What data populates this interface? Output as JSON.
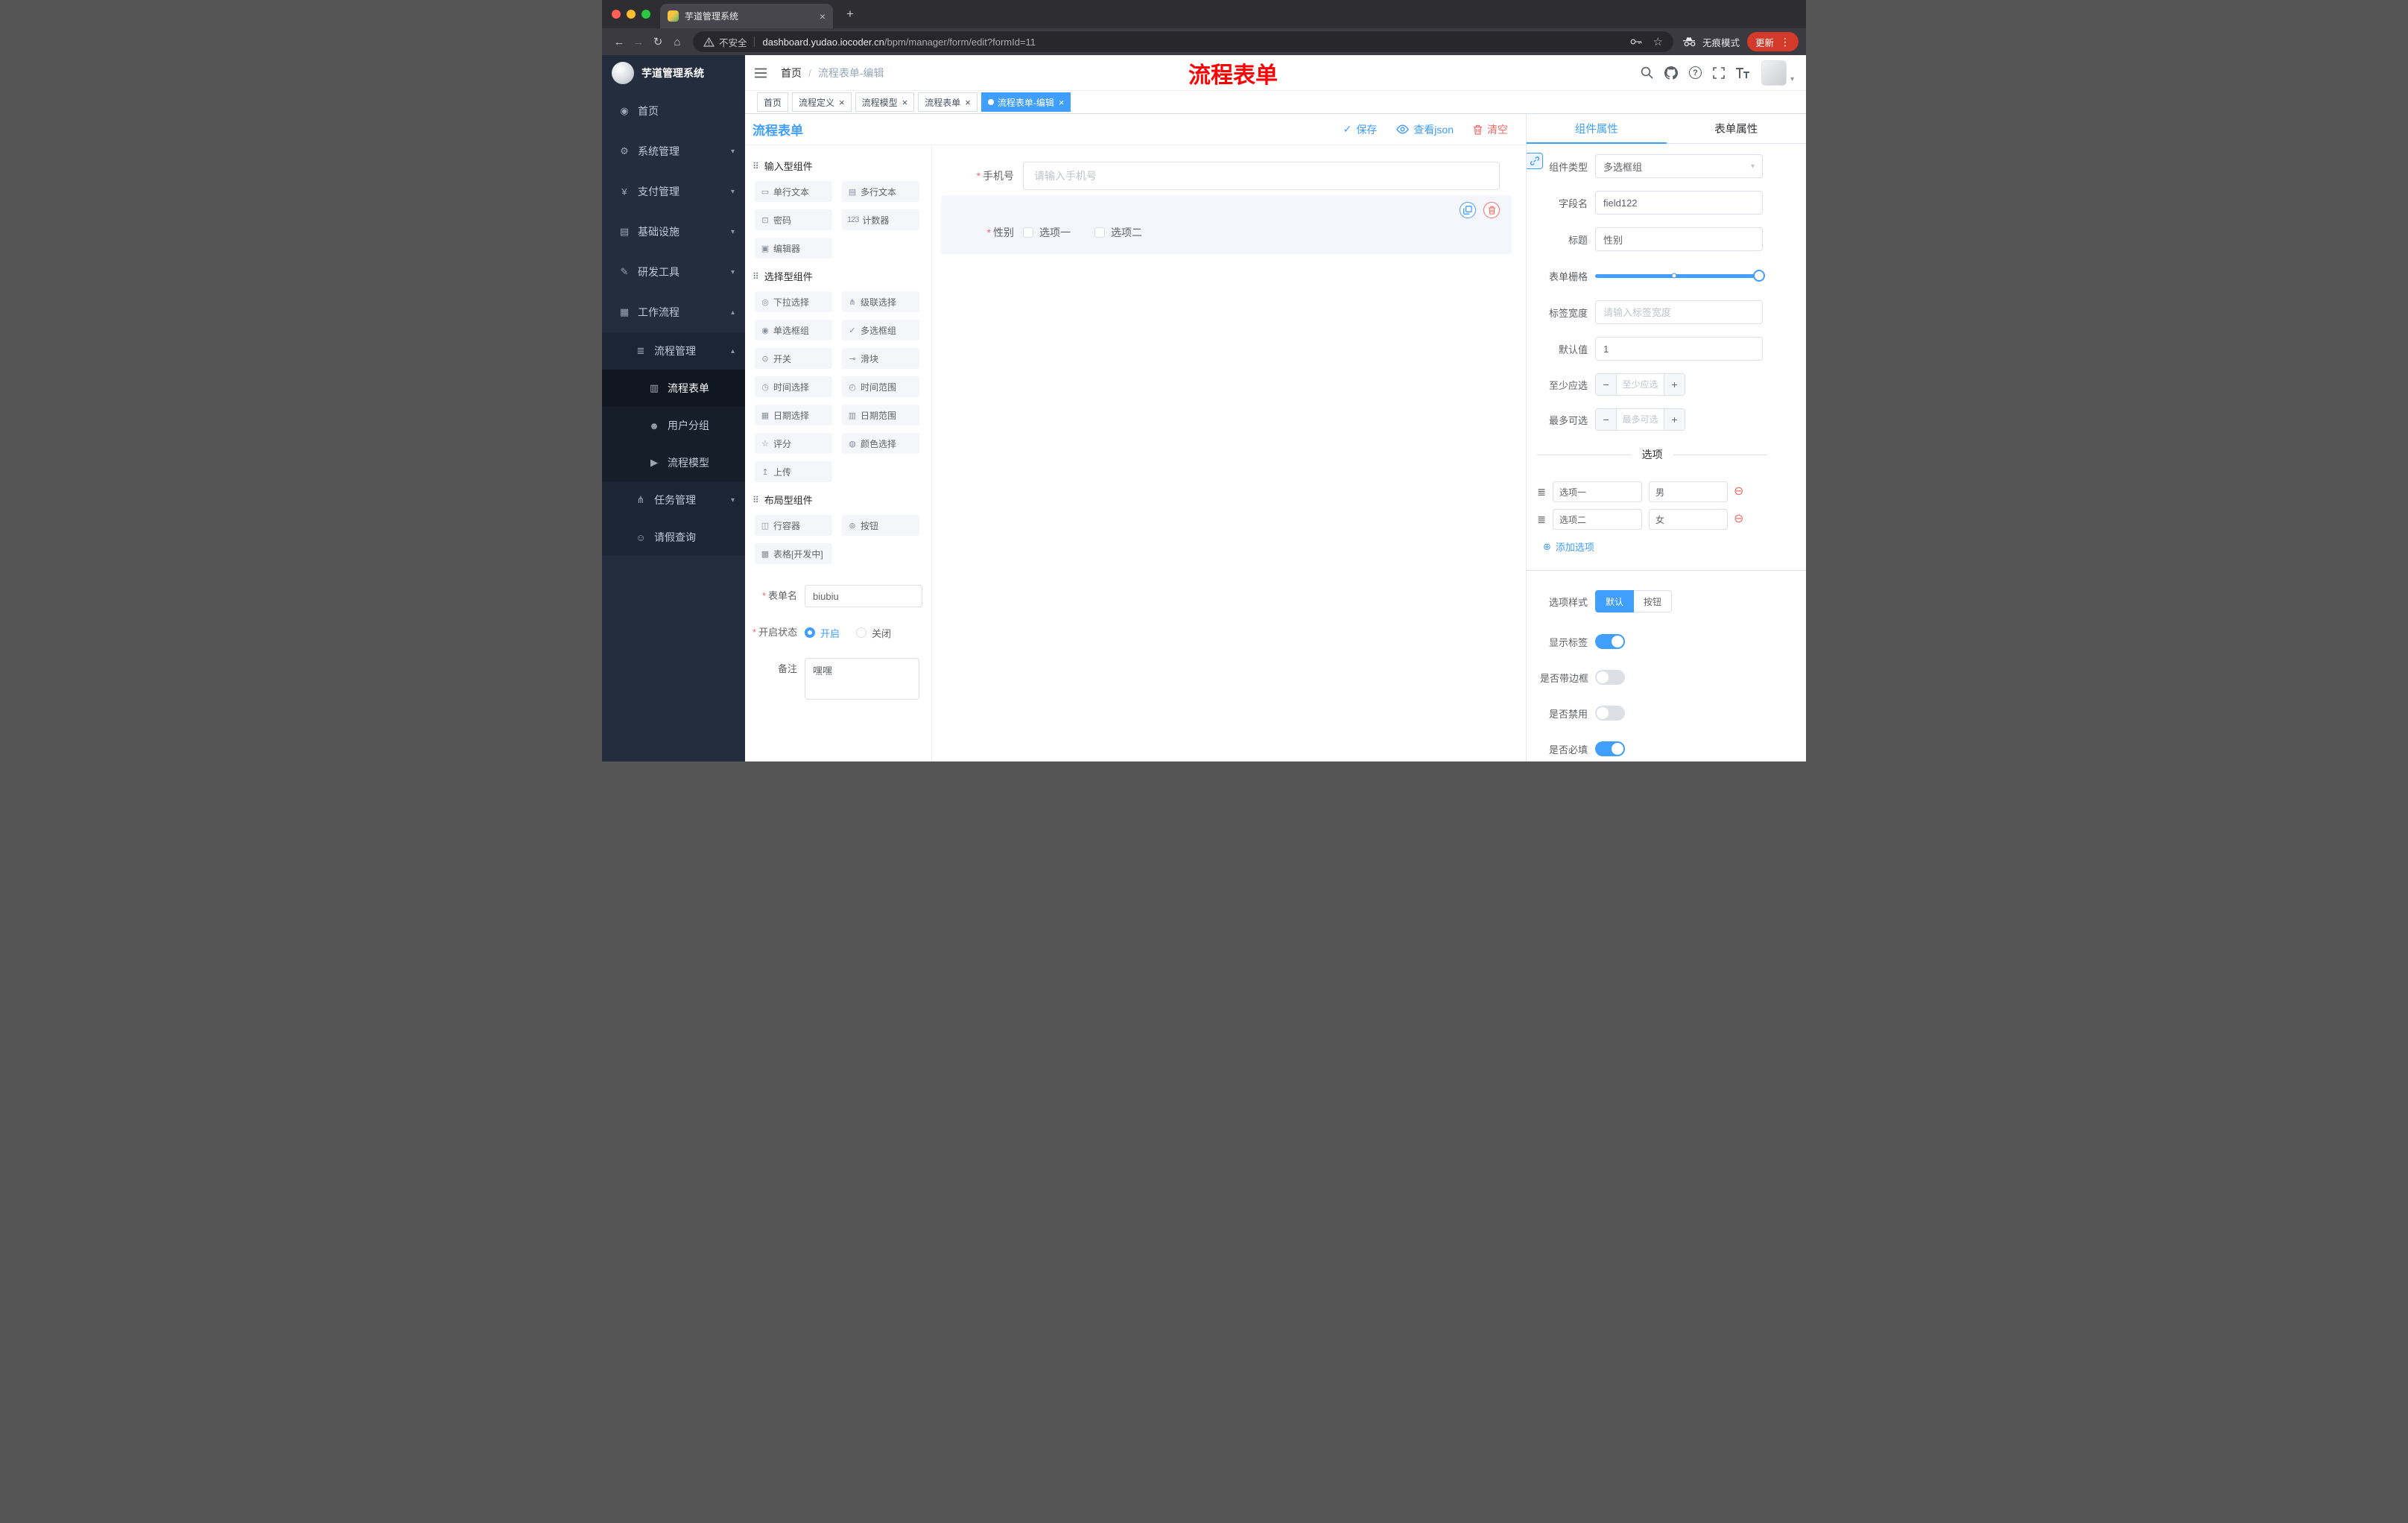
{
  "ui": {
    "required_mark": "*",
    "close_glyph": "×",
    "plus_glyph": "+",
    "back_glyph": "←",
    "forward_glyph": "→",
    "reload_glyph": "↻",
    "home_glyph": "⌂",
    "kebab_glyph": "⋮",
    "star_glyph": "☆",
    "question_glyph": "?",
    "caret_down_glyph": "▾",
    "caret_up_glyph": "▴",
    "check_glyph": "✓",
    "drag_glyph": "≣",
    "remove_glyph": "⊖",
    "add_glyph": "⊕",
    "breadcrumb_sep": "/"
  },
  "browser": {
    "tab_title": "芋道管理系统",
    "security_label": "不安全",
    "url_domain": "dashboard.yudao.iocoder.cn",
    "url_path": "/bpm/manager/form/edit?formId=11",
    "incognito_label": "无痕模式",
    "update_label": "更新"
  },
  "sidebar": {
    "logo_title": "芋道管理系统",
    "items": [
      {
        "label": "首页",
        "icon": "home-icon",
        "glyph": "◉",
        "level": 1
      },
      {
        "label": "系统管理",
        "icon": "system-management-icon",
        "glyph": "⚙",
        "level": 1,
        "arrow": "down"
      },
      {
        "label": "支付管理",
        "icon": "payment-management-icon",
        "glyph": "¥",
        "level": 1,
        "arrow": "down"
      },
      {
        "label": "基础设施",
        "icon": "infrastructure-icon",
        "glyph": "▤",
        "level": 1,
        "arrow": "down"
      },
      {
        "label": "研发工具",
        "icon": "dev-tools-icon",
        "glyph": "✎",
        "level": 1,
        "arrow": "down"
      },
      {
        "label": "工作流程",
        "icon": "workflow-icon",
        "glyph": "▦",
        "level": 1,
        "arrow": "up"
      },
      {
        "label": "流程管理",
        "icon": "process-management-icon",
        "glyph": "≣",
        "level": 2,
        "arrow": "up"
      },
      {
        "label": "流程表单",
        "icon": "process-form-icon",
        "glyph": "▥",
        "level": 3,
        "active": true
      },
      {
        "label": "用户分组",
        "icon": "user-group-icon",
        "glyph": "☻",
        "level": 3
      },
      {
        "label": "流程模型",
        "icon": "process-model-icon",
        "glyph": "▶",
        "level": 3
      },
      {
        "label": "任务管理",
        "icon": "task-management-icon",
        "glyph": "⋔",
        "level": 2,
        "arrow": "down"
      },
      {
        "label": "请假查询",
        "icon": "leave-query-icon",
        "glyph": "☺",
        "level": 2
      }
    ]
  },
  "header": {
    "breadcrumb_home": "首页",
    "breadcrumb_current": "流程表单-编辑",
    "annotation": "流程表单",
    "annotation_color": "#ff0000"
  },
  "tags": [
    {
      "label": "首页",
      "closable": false,
      "active": false
    },
    {
      "label": "流程定义",
      "closable": true,
      "active": false
    },
    {
      "label": "流程模型",
      "closable": true,
      "active": false
    },
    {
      "label": "流程表单",
      "closable": true,
      "active": false
    },
    {
      "label": "流程表单-编辑",
      "closable": true,
      "active": true
    }
  ],
  "designer": {
    "title": "流程表单",
    "toolbar": {
      "save": "保存",
      "view_json": "查看json",
      "clear": "清空"
    },
    "sections": [
      {
        "title": "输入型组件",
        "icon": "input-components-icon",
        "glyph": "⠿",
        "items": [
          {
            "label": "单行文本",
            "icon": "single-line-text-icon",
            "glyph": "▭"
          },
          {
            "label": "多行文本",
            "icon": "multi-line-text-icon",
            "glyph": "▤"
          },
          {
            "label": "密码",
            "icon": "password-icon",
            "glyph": "⊡"
          },
          {
            "label": "计数器",
            "icon": "counter-icon",
            "glyph": "123"
          },
          {
            "label": "编辑器",
            "icon": "editor-icon",
            "glyph": "▣"
          }
        ]
      },
      {
        "title": "选择型组件",
        "icon": "select-components-icon",
        "glyph": "⠿",
        "items": [
          {
            "label": "下拉选择",
            "icon": "select-icon",
            "glyph": "◎"
          },
          {
            "label": "级联选择",
            "icon": "cascader-icon",
            "glyph": "⋔"
          },
          {
            "label": "单选框组",
            "icon": "radio-group-icon",
            "glyph": "◉"
          },
          {
            "label": "多选框组",
            "icon": "checkbox-group-icon",
            "glyph": "✓"
          },
          {
            "label": "开关",
            "icon": "switch-icon",
            "glyph": "⊙"
          },
          {
            "label": "滑块",
            "icon": "slider-icon",
            "glyph": "⊸"
          },
          {
            "label": "时间选择",
            "icon": "time-picker-icon",
            "glyph": "◷"
          },
          {
            "label": "时间范围",
            "icon": "time-range-icon",
            "glyph": "◴"
          },
          {
            "label": "日期选择",
            "icon": "date-picker-icon",
            "glyph": "▦"
          },
          {
            "label": "日期范围",
            "icon": "date-range-icon",
            "glyph": "▥"
          },
          {
            "label": "评分",
            "icon": "rate-icon",
            "glyph": "☆"
          },
          {
            "label": "颜色选择",
            "icon": "color-picker-icon",
            "glyph": "◍"
          },
          {
            "label": "上传",
            "icon": "upload-icon",
            "glyph": "↥"
          }
        ]
      },
      {
        "title": "布局型组件",
        "icon": "layout-components-icon",
        "glyph": "⠿",
        "items": [
          {
            "label": "行容器",
            "icon": "row-container-icon",
            "glyph": "◫"
          },
          {
            "label": "按钮",
            "icon": "button-icon",
            "glyph": "⊚"
          },
          {
            "label": "表格[开发中]",
            "icon": "table-icon",
            "glyph": "▩"
          }
        ]
      }
    ],
    "meta": {
      "name_label": "表单名",
      "name_value": "biubiu",
      "status_label": "开启状态",
      "status_on": "开启",
      "status_off": "关闭",
      "status_value": "开启",
      "remark_label": "备注",
      "remark_value": "嘿嘿"
    },
    "canvas": {
      "phone": {
        "label": "手机号",
        "placeholder": "请输入手机号"
      },
      "gender": {
        "label": "性别",
        "option1": "选项一",
        "option2": "选项二"
      }
    }
  },
  "props": {
    "tab_component": "组件属性",
    "tab_form": "表单属性",
    "component_type": {
      "label": "组件类型",
      "value": "多选框组"
    },
    "field_name": {
      "label": "字段名",
      "value": "field122"
    },
    "title": {
      "label": "标题",
      "value": "性别"
    },
    "grid": {
      "label": "表单栅格"
    },
    "label_width": {
      "label": "标签宽度",
      "placeholder": "请输入标签宽度"
    },
    "default_value": {
      "label": "默认值",
      "value": "1"
    },
    "min_select": {
      "label": "至少应选",
      "placeholder": "至少应选"
    },
    "max_select": {
      "label": "最多可选",
      "placeholder": "最多可选"
    },
    "options_title": "选项",
    "options": [
      {
        "name": "选项一",
        "value": "男"
      },
      {
        "name": "选项二",
        "value": "女"
      }
    ],
    "add_option": "添加选项",
    "option_style": {
      "label": "选项样式",
      "default": "默认",
      "button": "按钮",
      "value": "默认"
    },
    "toggles": [
      {
        "label": "显示标签",
        "on": true
      },
      {
        "label": "是否带边框",
        "on": false
      },
      {
        "label": "是否禁用",
        "on": false
      },
      {
        "label": "是否必填",
        "on": true
      }
    ],
    "accent_color": "#409eff",
    "danger_color": "#f56c6c"
  }
}
